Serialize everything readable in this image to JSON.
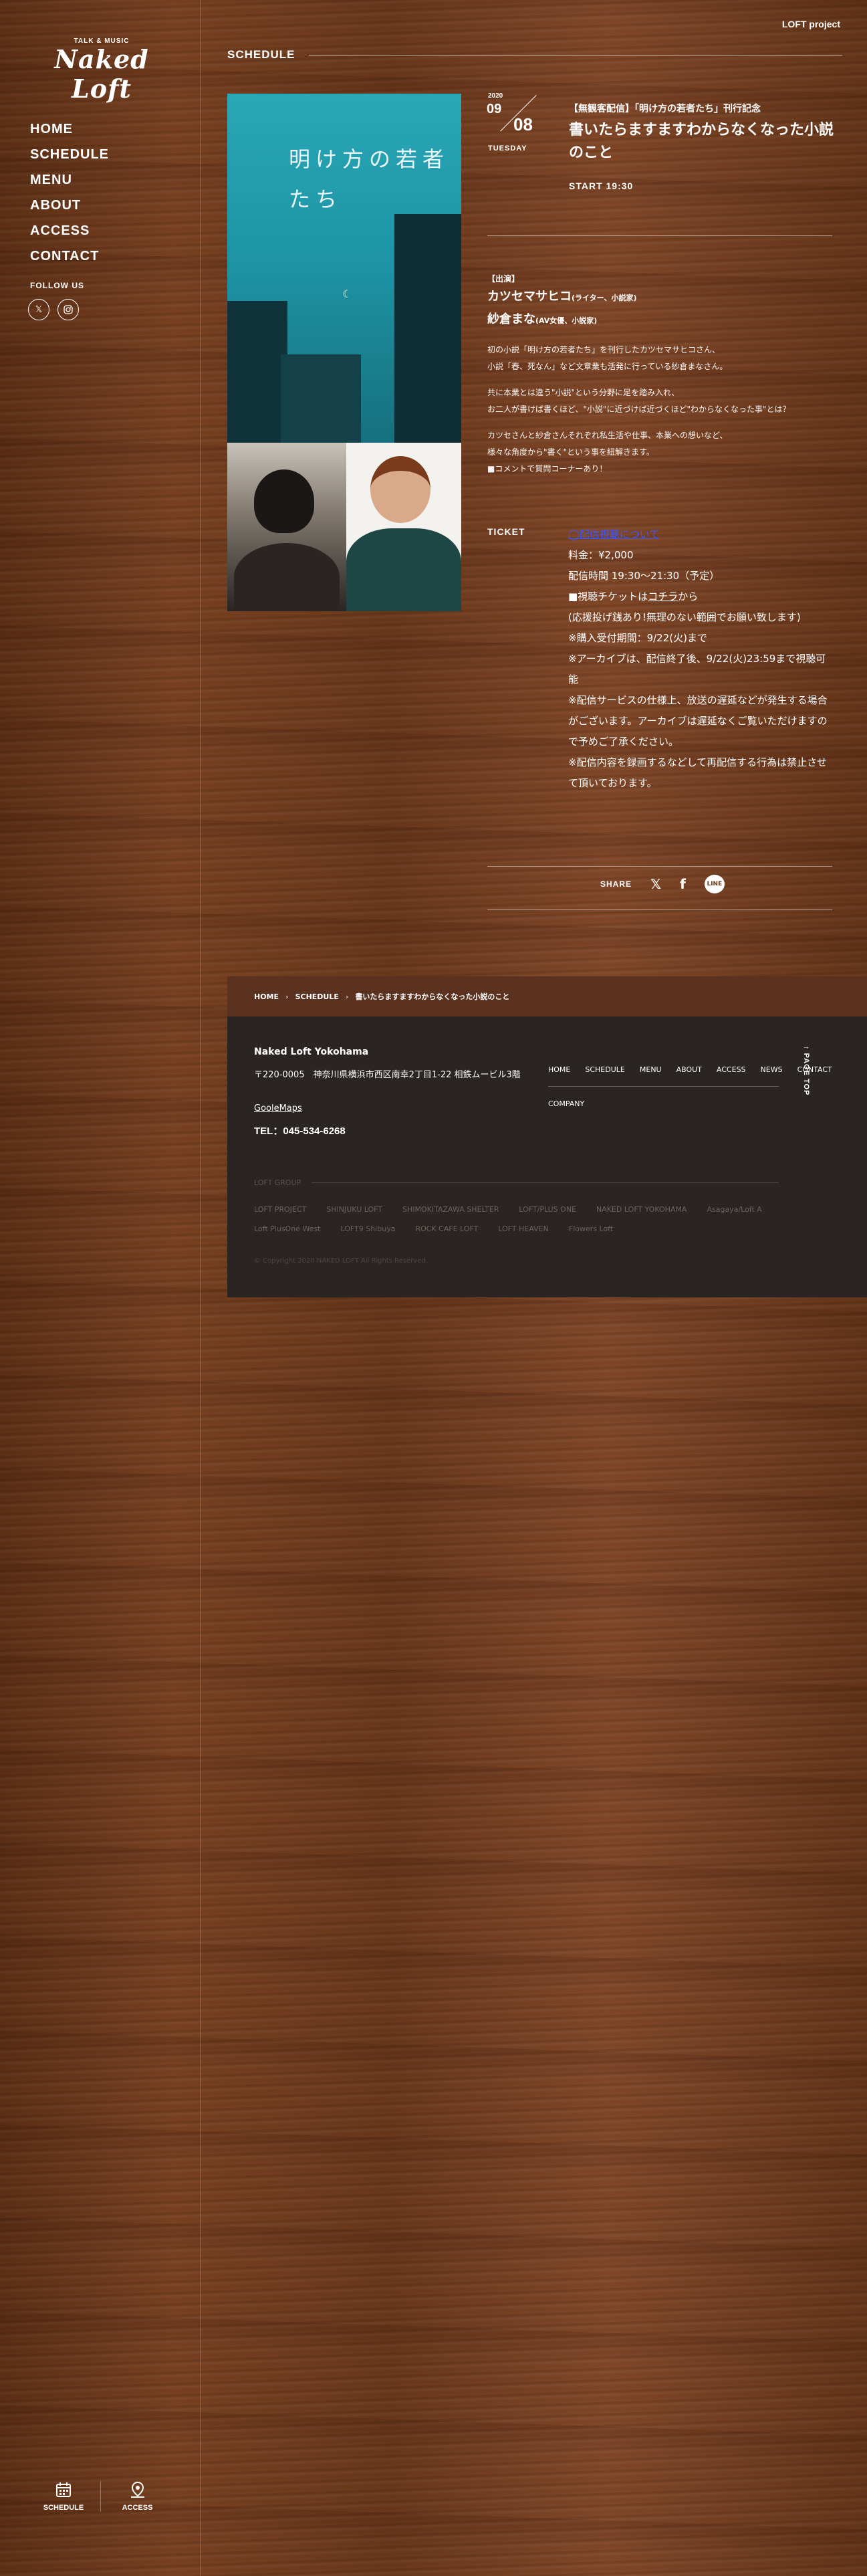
{
  "brand": {
    "small": "TALK & MUSIC",
    "name": "Naked Loft"
  },
  "top_link": "LOFT project",
  "nav": [
    "HOME",
    "SCHEDULE",
    "MENU",
    "ABOUT",
    "ACCESS",
    "CONTACT"
  ],
  "follow_label": "FOLLOW US",
  "section_title": "SCHEDULE",
  "event": {
    "year": "2020",
    "month": "09",
    "day": "08",
    "weekday": "TUESDAY",
    "subtitle": "【無観客配信】「明け方の若者たち」刊行記念",
    "title": "書いたらますますわからなくなった小説のこと",
    "start": "START 19:30"
  },
  "poster_title": "明け方の若者たち",
  "performers": {
    "label": "【出演】",
    "p1_name": "カツセマサヒコ",
    "p1_role": "(ライター、小説家)",
    "p2_name": "紗倉まな",
    "p2_role": "(AV女優、小説家)",
    "desc1a": "初の小説「明け方の若者たち」を刊行したカツセマサヒコさん、",
    "desc1b": "小説「春、死なん」など文章業も活発に行っている紗倉まなさん。",
    "desc2a": "共に本業とは違う\"小説\"という分野に足を踏み入れ、",
    "desc2b": "お二人が書けば書くほど、\"小説\"に近づけば近づくほど\"わからなくなった事\"とは？",
    "desc3a": "カツセさんと紗倉さんそれぞれ私生活や仕事、本業への想いなど、",
    "desc3b": "様々な角度から\"書く\"という事を紐解きます。",
    "desc4": "■コメントで質問コーナーあり！"
  },
  "ticket": {
    "label": "TICKET",
    "link": "◯配信視聴について",
    "price": "料金：¥2,000",
    "time": "配信時間 19:30〜21:30（予定）",
    "buy_prefix": "■視聴チケットは",
    "buy_link": "コチラ",
    "buy_suffix": "から",
    "tip": "(応援投げ銭あり!無理のない範囲でお願い致します)",
    "period": "※購入受付期間：9/22(火)まで",
    "archive": "※アーカイブは、配信終了後、9/22(火)23:59まで視聴可能",
    "note1": "※配信サービスの仕様上、放送の遅延などが発生する場合がございます。アーカイブは遅延なくご覧いただけますので予めご了承ください。",
    "note2": "※配信内容を録画するなどして再配信する行為は禁止させて頂いております。"
  },
  "share": {
    "label": "SHARE",
    "line": "LINE"
  },
  "breadcrumb": [
    "HOME",
    "SCHEDULE",
    "書いたらますますわからなくなった小説のこと"
  ],
  "footer": {
    "name": "Naked Loft Yokohama",
    "address": "〒220-0005　神奈川県横浜市西区南幸2丁目1-22 相鉄ムービル3階",
    "map": "GooleMaps",
    "tel": "TEL：045-534-6268",
    "nav": [
      "HOME",
      "SCHEDULE",
      "MENU",
      "ABOUT",
      "ACCESS",
      "NEWS",
      "CONTACT"
    ],
    "company": "COMPANY",
    "pagetop": "PAGE TOP",
    "group_label": "LOFT GROUP",
    "group_links": [
      "LOFT PROJECT",
      "SHINJUKU LOFT",
      "SHIMOKITAZAWA SHELTER",
      "LOFT/PLUS ONE",
      "NAKED LOFT YOKOHAMA",
      "Asagaya/Loft A",
      "Loft PlusOne West",
      "LOFT9 Shibuya",
      "ROCK CAFE LOFT",
      "LOFT HEAVEN",
      "Flowers Loft"
    ],
    "copyright": "© Copyright 2020 NAKED LOFT All Rights Reserved."
  },
  "bottom_nav": [
    "SCHEDULE",
    "ACCESS"
  ]
}
